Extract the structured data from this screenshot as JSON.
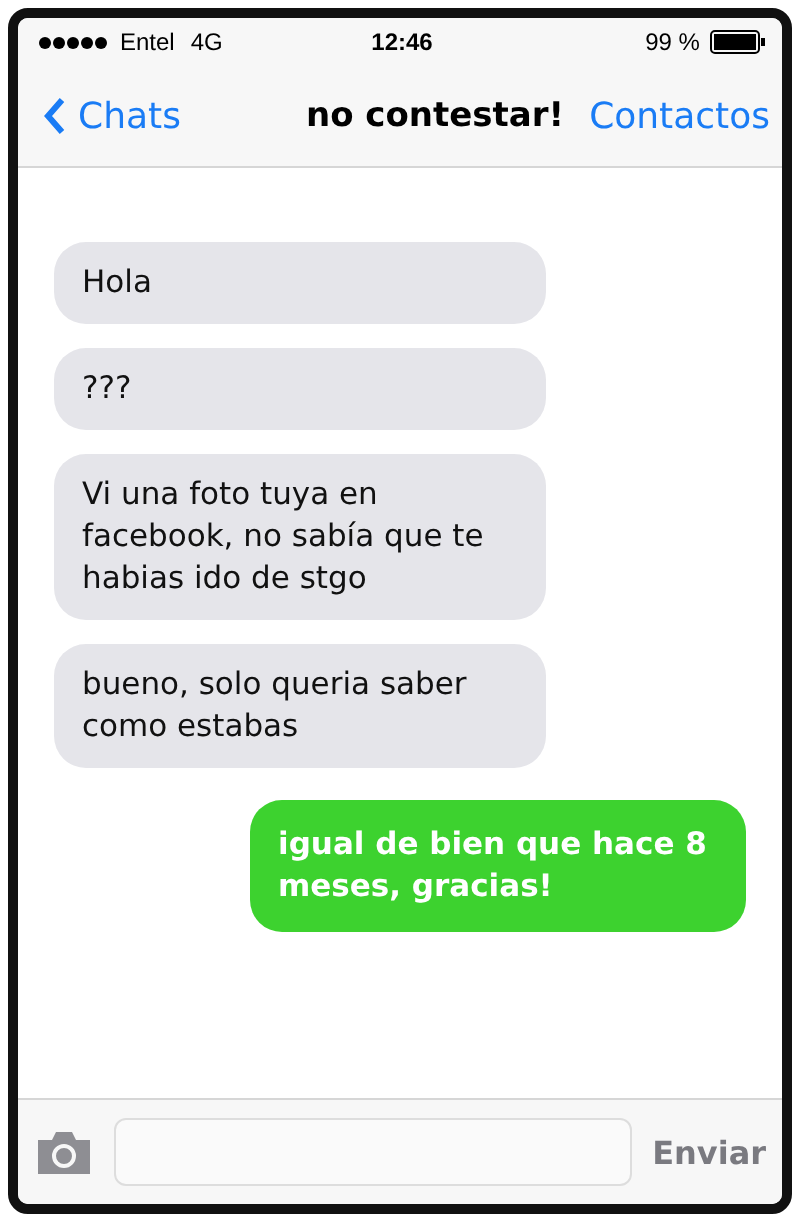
{
  "status_bar": {
    "carrier": "Entel",
    "network": "4G",
    "time": "12:46",
    "battery": "99 %"
  },
  "nav": {
    "back": "Chats",
    "title": "no contestar!",
    "action": "Contactos"
  },
  "messages": [
    {
      "kind": "incoming",
      "text": "Hola"
    },
    {
      "kind": "incoming",
      "text": "???"
    },
    {
      "kind": "incoming",
      "text": "Vi una foto tuya en facebook, no sabía que te habias ido de stgo"
    },
    {
      "kind": "incoming",
      "text": "bueno, solo queria saber como estabas"
    },
    {
      "kind": "outgoing",
      "text": "igual de bien que hace 8 meses, gracias!"
    }
  ],
  "composer": {
    "send": "Enviar"
  }
}
